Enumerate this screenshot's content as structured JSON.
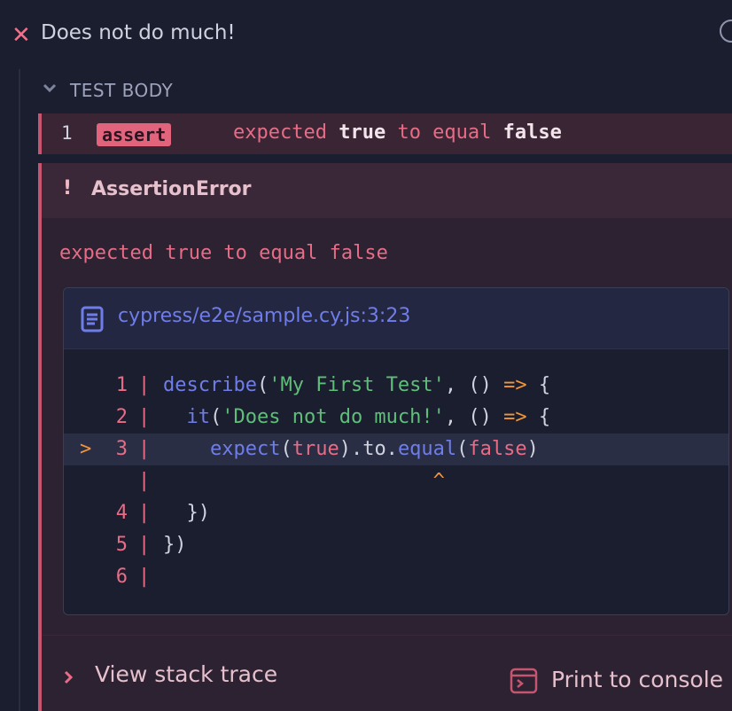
{
  "test": {
    "title": "Does not do much!",
    "status_icon": "fail-x-icon",
    "timer_icon": "clock-icon"
  },
  "section": {
    "label": "TEST BODY"
  },
  "command": {
    "number": "1",
    "name": "assert",
    "message_parts": [
      "expected ",
      "true",
      " to equal ",
      "false"
    ]
  },
  "error": {
    "name": "AssertionError",
    "bang": "!",
    "message": "expected true to equal false",
    "file_link": "cypress/e2e/sample.cy.js:3:23",
    "code": [
      {
        "ln": "1",
        "arrow": "",
        "parts": [
          [
            "fn",
            "describe"
          ],
          [
            "p",
            "("
          ],
          [
            "str",
            "'My First Test'"
          ],
          [
            "p",
            ", () "
          ],
          [
            "op",
            "=>"
          ],
          [
            "p",
            " {"
          ]
        ]
      },
      {
        "ln": "2",
        "arrow": "",
        "parts": [
          [
            "p",
            "  "
          ],
          [
            "fn",
            "it"
          ],
          [
            "p",
            "("
          ],
          [
            "str",
            "'Does not do much!'"
          ],
          [
            "p",
            ", () "
          ],
          [
            "op",
            "=>"
          ],
          [
            "p",
            " {"
          ]
        ]
      },
      {
        "ln": "3",
        "arrow": ">",
        "parts": [
          [
            "p",
            "    "
          ],
          [
            "fn",
            "expect"
          ],
          [
            "p",
            "("
          ],
          [
            "kw",
            "true"
          ],
          [
            "p",
            ").to."
          ],
          [
            "fn",
            "equal"
          ],
          [
            "p",
            "("
          ],
          [
            "kw",
            "false"
          ],
          [
            "p",
            ")"
          ]
        ]
      },
      {
        "ln": "",
        "arrow": "",
        "parts": [
          [
            "caret",
            "                       ^"
          ]
        ]
      },
      {
        "ln": "4",
        "arrow": "",
        "parts": [
          [
            "p",
            "  })"
          ]
        ]
      },
      {
        "ln": "5",
        "arrow": "",
        "parts": [
          [
            "p",
            "})"
          ]
        ]
      },
      {
        "ln": "6",
        "arrow": "",
        "parts": []
      }
    ],
    "view_stack_trace": "View stack trace",
    "print_to_console": "Print to console"
  },
  "colors": {
    "background": "#1b1e2e",
    "fail_red": "#e86c86",
    "link_indigo": "#6f7de8",
    "string_green": "#5fbf7a",
    "operator_orange": "#f0953a"
  }
}
